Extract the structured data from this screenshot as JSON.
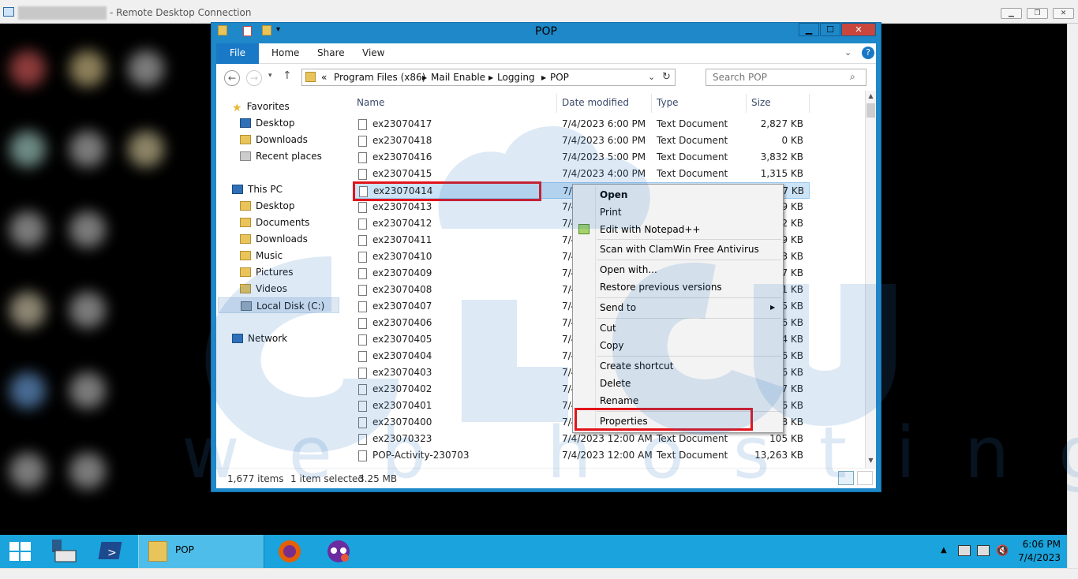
{
  "rdp": {
    "title": "- Remote Desktop Connection"
  },
  "explorer": {
    "title": "POP",
    "ribbon": {
      "file": "File",
      "home": "Home",
      "share": "Share",
      "view": "View"
    },
    "address": {
      "prefix": "«",
      "crumbs": [
        "Program Files (x86)",
        "Mail Enable",
        "Logging",
        "POP"
      ]
    },
    "search": {
      "placeholder": "Search POP"
    },
    "nav": {
      "favorites": "Favorites",
      "desktop": "Desktop",
      "downloads": "Downloads",
      "recent": "Recent places",
      "this_pc": "This PC",
      "pc_desktop": "Desktop",
      "documents": "Documents",
      "pc_downloads": "Downloads",
      "music": "Music",
      "pictures": "Pictures",
      "videos": "Videos",
      "local_disk": "Local Disk (C:)",
      "network": "Network"
    },
    "columns": {
      "name": "Name",
      "date": "Date modified",
      "type": "Type",
      "size": "Size"
    },
    "files": [
      {
        "name": "ex23070417",
        "date": "7/4/2023 6:00 PM",
        "type": "Text Document",
        "size": "2,827 KB"
      },
      {
        "name": "ex23070418",
        "date": "7/4/2023 6:00 PM",
        "type": "Text Document",
        "size": "0 KB"
      },
      {
        "name": "ex23070416",
        "date": "7/4/2023 5:00 PM",
        "type": "Text Document",
        "size": "3,832 KB"
      },
      {
        "name": "ex23070415",
        "date": "7/4/2023 4:00 PM",
        "type": "Text Document",
        "size": "1,315 KB"
      },
      {
        "name": "ex23070414",
        "date": "7/4",
        "type": "",
        "size": "37 KB"
      },
      {
        "name": "ex23070413",
        "date": "7/4",
        "type": "",
        "size": "59 KB"
      },
      {
        "name": "ex23070412",
        "date": "7/4",
        "type": "",
        "size": "02 KB"
      },
      {
        "name": "ex23070411",
        "date": "7/4",
        "type": "",
        "size": "19 KB"
      },
      {
        "name": "ex23070410",
        "date": "7/4",
        "type": "",
        "size": "33 KB"
      },
      {
        "name": "ex23070409",
        "date": "7/4",
        "type": "",
        "size": "07 KB"
      },
      {
        "name": "ex23070408",
        "date": "7/4",
        "type": "",
        "size": "41 KB"
      },
      {
        "name": "ex23070407",
        "date": "7/4",
        "type": "",
        "size": "05 KB"
      },
      {
        "name": "ex23070406",
        "date": "7/4",
        "type": "",
        "size": "96 KB"
      },
      {
        "name": "ex23070405",
        "date": "7/4",
        "type": "",
        "size": "34 KB"
      },
      {
        "name": "ex23070404",
        "date": "7/4",
        "type": "",
        "size": "06 KB"
      },
      {
        "name": "ex23070403",
        "date": "7/4",
        "type": "",
        "size": "26 KB"
      },
      {
        "name": "ex23070402",
        "date": "7/4",
        "type": "",
        "size": "97 KB"
      },
      {
        "name": "ex23070401",
        "date": "7/4",
        "type": "",
        "size": "06 KB"
      },
      {
        "name": "ex23070400",
        "date": "7/4",
        "type": "",
        "size": "08 KB"
      },
      {
        "name": "ex23070323",
        "date": "7/4/2023 12:00 AM",
        "type": "Text Document",
        "size": "105 KB"
      },
      {
        "name": "POP-Activity-230703",
        "date": "7/4/2023 12:00 AM",
        "type": "Text Document",
        "size": "13,263 KB"
      }
    ],
    "status": {
      "items": "1,677 items",
      "selected": "1 item selected",
      "size": "3.25 MB"
    }
  },
  "context_menu": {
    "open": "Open",
    "print": "Print",
    "edit_notepad": "Edit with Notepad++",
    "scan": "Scan with ClamWin Free Antivirus",
    "open_with": "Open with...",
    "restore": "Restore previous versions",
    "send_to": "Send to",
    "cut": "Cut",
    "copy": "Copy",
    "create_shortcut": "Create shortcut",
    "delete": "Delete",
    "rename": "Rename",
    "properties": "Properties"
  },
  "taskbar": {
    "active_window": "POP",
    "time": "6:06 PM",
    "date": "7/4/2023"
  },
  "colors": {
    "accent": "#1e88c9",
    "taskbar": "#1aa3dc",
    "highlight": "#e3141b",
    "selection": "#cce4f7"
  }
}
